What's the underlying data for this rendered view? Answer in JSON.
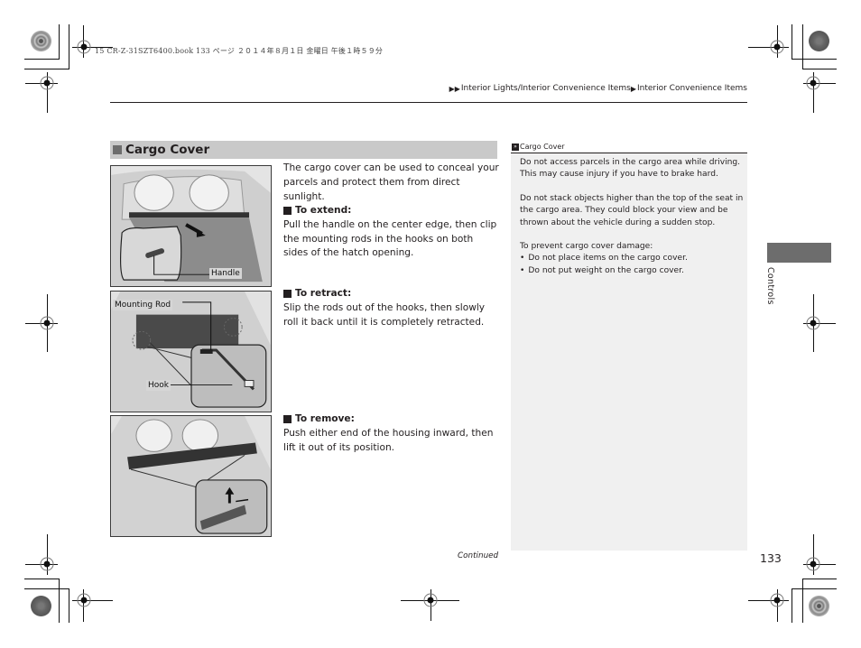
{
  "print_header": "15 CR-Z-31SZT6400.book  133 ページ  ２０１４年８月１日  金曜日  午後１時５９分",
  "breadcrumb": {
    "items": [
      "Interior Lights/Interior Convenience Items",
      "Interior Convenience Items"
    ]
  },
  "section": {
    "title": "Cargo Cover"
  },
  "figures": [
    {
      "callouts": [
        "Handle"
      ]
    },
    {
      "callouts": [
        "Mounting Rod",
        "Hook"
      ]
    },
    {
      "callouts": []
    }
  ],
  "main": {
    "intro": "The cargo cover can be used to conceal your parcels and protect them from direct sunlight.",
    "steps": [
      {
        "heading": "To extend:",
        "text": "Pull the handle on the center edge, then clip the mounting rods in the hooks on both sides of the hatch opening."
      },
      {
        "heading": "To retract:",
        "text": "Slip the rods out of the hooks, then slowly roll it back until it is completely retracted."
      },
      {
        "heading": "To remove:",
        "text": "Push either end of the housing inward, then lift it out of its position."
      }
    ]
  },
  "note": {
    "title": "Cargo Cover",
    "paragraphs": [
      "Do not access parcels in the cargo area while driving. This may cause injury if you have to brake hard.",
      "Do not stack objects higher than the top of the seat in the cargo area. They could block your view and be thrown about the vehicle during a sudden stop.",
      "To prevent cargo cover damage:"
    ],
    "bullets": [
      "Do not place items on the cargo cover.",
      "Do not put weight on the cargo cover."
    ]
  },
  "side_tab": {
    "label": "Controls"
  },
  "footer": {
    "continued": "Continued",
    "page_number": "133"
  }
}
